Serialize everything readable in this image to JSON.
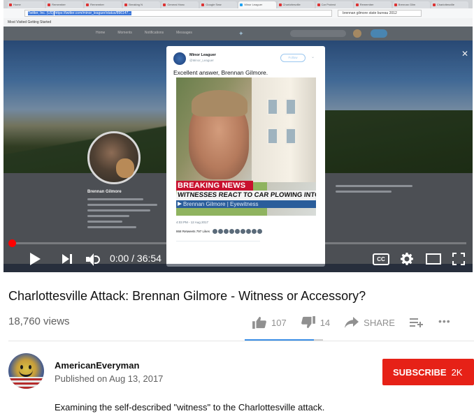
{
  "browser": {
    "tabs": [
      "Home",
      "Remember",
      "Remember",
      "Breaking N",
      "General Hanc",
      "Google Sear",
      "Minor Leaguer",
      "Charlottesville",
      "Car Protest",
      "Remember",
      "Brennan Gilm",
      "Charlottesville"
    ],
    "address": "https://twitter.com/minor_leaguer/status/896147...",
    "address_protocol": "Twitter, Inc. (US)",
    "search_text": "brennan gilmore state bureau 2012",
    "bookmarks": "Most Visited   Getting Started"
  },
  "twitter_page": {
    "nav": [
      "Home",
      "Moments",
      "Notifications",
      "Messages"
    ],
    "profile_name": "Brennan Gilmore"
  },
  "tweet": {
    "author_name": "Minor Leaguer",
    "author_handle": "@Minor_Leaguer",
    "follow_label": "Follow",
    "text": "Excellent answer, Brennan Gilmore.",
    "breaking_news": "BREAKING NEWS",
    "headline": "WITNESSES REACT TO CAR PLOWING INTO CR",
    "lower_third": "Brennan Gilmore | Eyewitness",
    "meta": "4:03 PM - 12 Aug 2017",
    "stats": "868 Retweets   797 Likes"
  },
  "player": {
    "time": "0:00 / 36:54",
    "progress": 0,
    "cc_label": "CC"
  },
  "video": {
    "title": "Charlottesville Attack: Brennan Gilmore - Witness or Accessory?",
    "views": "18,760 views",
    "likes": "107",
    "dislikes": "14",
    "share_label": "SHARE",
    "like_ratio": 0.88
  },
  "channel": {
    "name": "AmericanEveryman",
    "published": "Published on Aug 13, 2017",
    "subscribe_label": "SUBSCRIBE",
    "subscriber_count": "2K"
  },
  "description": "Examining the self-described \"witness\" to the Charlottesville attack.",
  "colors": {
    "subscribe": "#e62117",
    "progress": "#ff0000",
    "sentiment": "#3a8ee6",
    "breaking_news": "#c8102e"
  }
}
